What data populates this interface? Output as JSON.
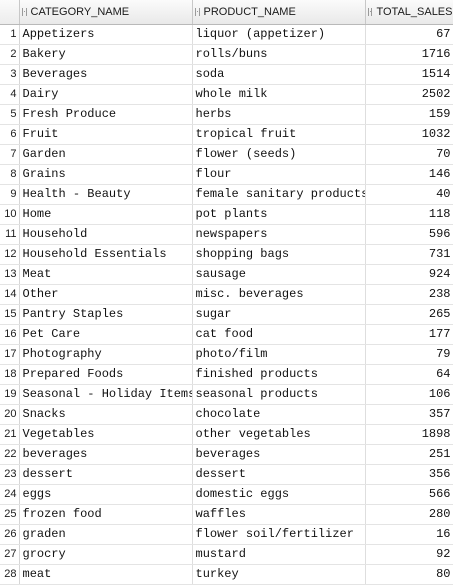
{
  "grid": {
    "columns": [
      "CATEGORY_NAME",
      "PRODUCT_NAME",
      "TOTAL_SALES"
    ],
    "rows": [
      {
        "n": "1",
        "category": "Appetizers",
        "product": "liquor (appetizer)",
        "total": "67"
      },
      {
        "n": "2",
        "category": "Bakery",
        "product": "rolls/buns",
        "total": "1716"
      },
      {
        "n": "3",
        "category": "Beverages",
        "product": "soda",
        "total": "1514"
      },
      {
        "n": "4",
        "category": "Dairy",
        "product": "whole milk",
        "total": "2502"
      },
      {
        "n": "5",
        "category": "Fresh Produce",
        "product": "herbs",
        "total": "159"
      },
      {
        "n": "6",
        "category": "Fruit",
        "product": "tropical fruit",
        "total": "1032"
      },
      {
        "n": "7",
        "category": "Garden",
        "product": "flower (seeds)",
        "total": "70"
      },
      {
        "n": "8",
        "category": "Grains",
        "product": "flour",
        "total": "146"
      },
      {
        "n": "9",
        "category": "Health - Beauty",
        "product": "female sanitary products",
        "total": "40"
      },
      {
        "n": "10",
        "category": "Home",
        "product": "pot plants",
        "total": "118"
      },
      {
        "n": "11",
        "category": "Household",
        "product": "newspapers",
        "total": "596"
      },
      {
        "n": "12",
        "category": "Household Essentials",
        "product": "shopping bags",
        "total": "731"
      },
      {
        "n": "13",
        "category": "Meat",
        "product": "sausage",
        "total": "924"
      },
      {
        "n": "14",
        "category": "Other",
        "product": "misc. beverages",
        "total": "238"
      },
      {
        "n": "15",
        "category": "Pantry Staples",
        "product": "sugar",
        "total": "265"
      },
      {
        "n": "16",
        "category": "Pet Care",
        "product": "cat food",
        "total": "177"
      },
      {
        "n": "17",
        "category": "Photography",
        "product": "photo/film",
        "total": "79"
      },
      {
        "n": "18",
        "category": "Prepared Foods",
        "product": "finished products",
        "total": "64"
      },
      {
        "n": "19",
        "category": "Seasonal - Holiday Items",
        "product": "seasonal products",
        "total": "106"
      },
      {
        "n": "20",
        "category": "Snacks",
        "product": "chocolate",
        "total": "357"
      },
      {
        "n": "21",
        "category": "Vegetables",
        "product": "other vegetables",
        "total": "1898"
      },
      {
        "n": "22",
        "category": "beverages",
        "product": "beverages",
        "total": "251"
      },
      {
        "n": "23",
        "category": "dessert",
        "product": "dessert",
        "total": "356"
      },
      {
        "n": "24",
        "category": "eggs",
        "product": "domestic eggs",
        "total": "566"
      },
      {
        "n": "25",
        "category": "frozen food",
        "product": "waffles",
        "total": "280"
      },
      {
        "n": "26",
        "category": "graden",
        "product": "flower soil/fertilizer",
        "total": "16"
      },
      {
        "n": "27",
        "category": "grocry",
        "product": "mustard",
        "total": "92"
      },
      {
        "n": "28",
        "category": "meat",
        "product": "turkey",
        "total": "80"
      }
    ]
  }
}
